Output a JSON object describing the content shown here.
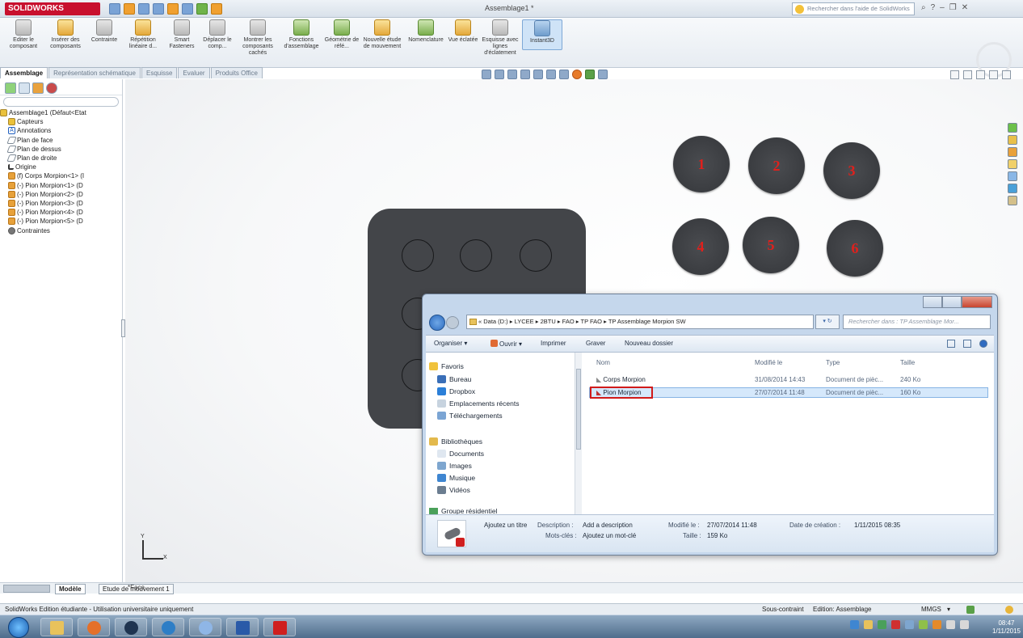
{
  "app": {
    "logo": "SOLIDWORKS",
    "title": "Assemblage1 *",
    "help_search_placeholder": "Rechercher dans l'aide de SolidWorks"
  },
  "commands": [
    {
      "label": "Editer le composant",
      "icon": "edit-component-icon"
    },
    {
      "label": "Insérer des composants",
      "icon": "insert-components-icon"
    },
    {
      "label": "Contrainte",
      "icon": "mate-icon"
    },
    {
      "label": "Répétition linéaire d...",
      "icon": "linear-pattern-icon"
    },
    {
      "label": "Smart Fasteners",
      "icon": "smart-fasteners-icon"
    },
    {
      "label": "Déplacer le comp...",
      "icon": "move-component-icon"
    },
    {
      "label": "Montrer les composants cachés",
      "icon": "show-hidden-icon"
    },
    {
      "label": "Fonctions d'assemblage",
      "icon": "assembly-features-icon"
    },
    {
      "label": "Géométrie de réfé...",
      "icon": "reference-geometry-icon"
    },
    {
      "label": "Nouvelle étude de mouvement",
      "icon": "motion-study-icon"
    },
    {
      "label": "Nomenclature",
      "icon": "bom-icon"
    },
    {
      "label": "Vue éclatée",
      "icon": "exploded-view-icon"
    },
    {
      "label": "Esquisse avec lignes d'éclatement",
      "icon": "explode-line-sketch-icon"
    },
    {
      "label": "Instant3D",
      "icon": "instant3d-icon"
    }
  ],
  "command_tabs": [
    "Assemblage",
    "Représentation schématique",
    "Esquisse",
    "Evaluer",
    "Produits Office"
  ],
  "feature_tree": [
    {
      "label": "Assemblage1 (Défaut<Etat",
      "icon": "assembly-icon"
    },
    {
      "label": "Capteurs",
      "icon": "sensors-icon"
    },
    {
      "label": "Annotations",
      "icon": "annotations-icon"
    },
    {
      "label": "Plan de face",
      "icon": "plane-icon"
    },
    {
      "label": "Plan de dessus",
      "icon": "plane-icon"
    },
    {
      "label": "Plan de droite",
      "icon": "plane-icon"
    },
    {
      "label": "Origine",
      "icon": "origin-icon"
    },
    {
      "label": "(f) Corps Morpion<1> (I",
      "icon": "part-icon"
    },
    {
      "label": "(-) Pion Morpion<1> (D",
      "icon": "part-icon"
    },
    {
      "label": "(-) Pion Morpion<2> (D",
      "icon": "part-icon"
    },
    {
      "label": "(-) Pion Morpion<3> (D",
      "icon": "part-icon"
    },
    {
      "label": "(-) Pion Morpion<4> (D",
      "icon": "part-icon"
    },
    {
      "label": "(-) Pion Morpion<5> (D",
      "icon": "part-icon"
    },
    {
      "label": "Contraintes",
      "icon": "mates-icon"
    }
  ],
  "pawns": [
    "1",
    "2",
    "3",
    "4",
    "5",
    "6"
  ],
  "triad": {
    "x": "X",
    "y": "Y"
  },
  "explorer": {
    "address": "« Data (D:) ▸ LYCEE ▸ 2BTU ▸ FAO ▸ TP FAO ▸ TP Assemblage Morpion SW",
    "search_placeholder": "Rechercher dans : TP Assemblage Mor...",
    "toolbar": {
      "organize": "Organiser ▾",
      "open": "Ouvrir ▾",
      "print": "Imprimer",
      "burn": "Graver",
      "new_folder": "Nouveau dossier"
    },
    "nav": {
      "favorites": "Favoris",
      "favorites_items": [
        "Bureau",
        "Dropbox",
        "Emplacements récents",
        "Téléchargements"
      ],
      "libraries": "Bibliothèques",
      "libraries_items": [
        "Documents",
        "Images",
        "Musique",
        "Vidéos"
      ],
      "homegroup": "Groupe résidentiel"
    },
    "columns": {
      "name": "Nom",
      "modified": "Modifié le",
      "type": "Type",
      "size": "Taille"
    },
    "files": [
      {
        "name": "Corps Morpion",
        "modified": "31/08/2014 14:43",
        "type": "Document de pièc...",
        "size": "240 Ko"
      },
      {
        "name": "Pion Morpion",
        "modified": "27/07/2014 11:48",
        "type": "Document de pièc...",
        "size": "160 Ko"
      }
    ],
    "details": {
      "title_label": "Ajoutez un titre",
      "description_label": "Description :",
      "description_value": "Add a description",
      "keywords_label": "Mots-clés :",
      "keywords_value": "Ajoutez un mot-clé",
      "modified_label": "Modifié le :",
      "modified_value": "27/07/2014 11:48",
      "size_label": "Taille :",
      "size_value": "159 Ko",
      "created_label": "Date de création :",
      "created_value": "1/11/2015 08:35"
    }
  },
  "bottom_tabs": [
    "Modèle",
    "Etude de mouvement 1"
  ],
  "face_label": "*Face",
  "status": {
    "left": "SolidWorks Edition étudiante - Utilisation universitaire uniquement",
    "constraint": "Sous-contraint",
    "mode": "Edition: Assemblage",
    "units": "MMGS",
    "units_arrow": "▾"
  },
  "taskbar": {
    "time": "08:47",
    "date": "1/11/2015"
  }
}
